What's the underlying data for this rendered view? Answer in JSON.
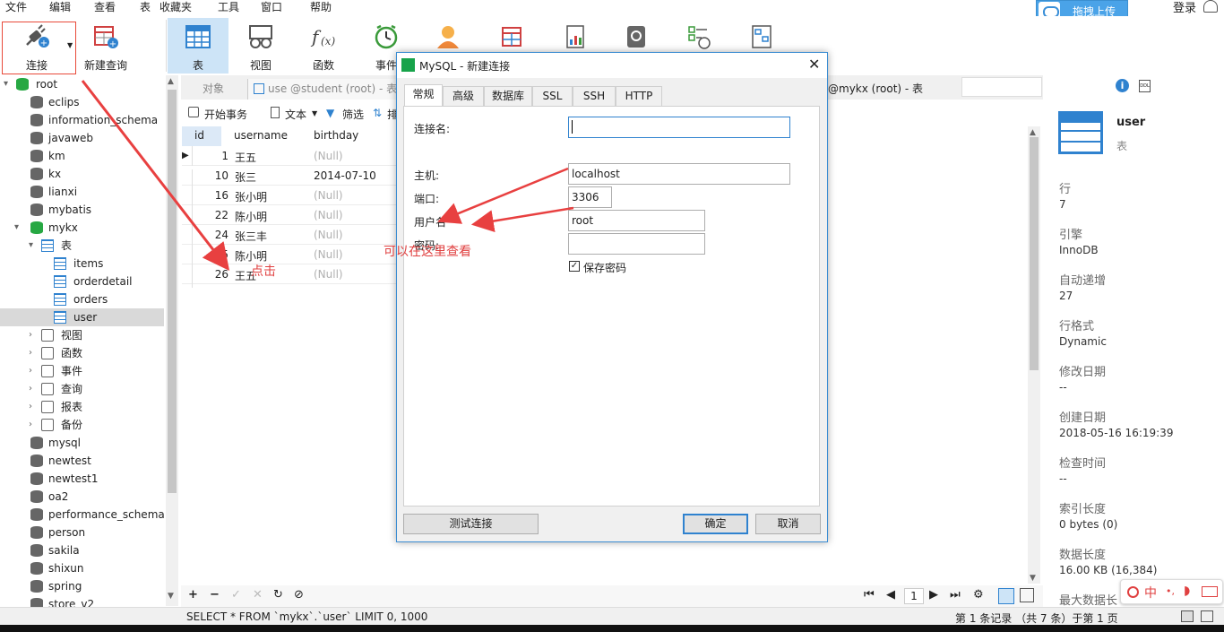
{
  "menu": {
    "items": [
      "文件",
      "编辑",
      "查看",
      "表",
      "收藏夹",
      "工具",
      "窗口",
      "帮助"
    ]
  },
  "topright": {
    "cloud_label": "拖拽上传",
    "login_label": "登录"
  },
  "toolbar": {
    "items": [
      {
        "label": "连接",
        "icon": "plug-icon"
      },
      {
        "label": "新建查询",
        "icon": "new-query-icon"
      },
      {
        "label": "表",
        "icon": "table-icon"
      },
      {
        "label": "视图",
        "icon": "view-icon"
      },
      {
        "label": "函数",
        "icon": "function-icon"
      },
      {
        "label": "事件",
        "icon": "clock-icon"
      }
    ]
  },
  "tree": {
    "root_label": "root",
    "dbs_before": [
      "eclips",
      "information_schema",
      "javaweb",
      "km",
      "kx",
      "lianxi",
      "mybatis"
    ],
    "open_db": "mykx",
    "tables_folder": "表",
    "tables": [
      "items",
      "orderdetail",
      "orders",
      "user"
    ],
    "folders": [
      "视图",
      "函数",
      "事件",
      "查询",
      "报表",
      "备份"
    ],
    "dbs_after": [
      "mysql",
      "newtest",
      "newtest1",
      "oa2",
      "performance_schema",
      "person",
      "sakila",
      "shixun",
      "spring",
      "store_v2"
    ]
  },
  "tabs": {
    "objects": "对象",
    "query_tab": "use @student (root) - 表",
    "right_tab": "@mykx (root) - 表"
  },
  "subtoolbar": {
    "begin_tx": "开始事务",
    "text": "文本",
    "filter": "筛选",
    "sort": "排"
  },
  "grid": {
    "columns": [
      "id",
      "username",
      "birthday"
    ],
    "rows": [
      {
        "id": "1",
        "username": "王五",
        "birthday": "(Null)"
      },
      {
        "id": "10",
        "username": "张三",
        "birthday": "2014-07-10"
      },
      {
        "id": "16",
        "username": "张小明",
        "birthday": "(Null)"
      },
      {
        "id": "22",
        "username": "陈小明",
        "birthday": "(Null)"
      },
      {
        "id": "24",
        "username": "张三丰",
        "birthday": "(Null)"
      },
      {
        "id": "25",
        "username": "陈小明",
        "birthday": "(Null)"
      },
      {
        "id": "26",
        "username": "王五",
        "birthday": "(Null)"
      }
    ]
  },
  "dialog": {
    "title": "MySQL - 新建连接",
    "tabs": [
      "常规",
      "高级",
      "数据库",
      "SSL",
      "SSH",
      "HTTP"
    ],
    "conn_name_label": "连接名:",
    "conn_name_value": "",
    "host_label": "主机:",
    "host_value": "localhost",
    "port_label": "端口:",
    "port_value": "3306",
    "user_label": "用户名",
    "user_value": "root",
    "pass_label": "密码:",
    "pass_value": "",
    "save_pass_label": "保存密码",
    "save_pass_checked": "✓",
    "test_button": "测试连接",
    "ok_button": "确定",
    "cancel_button": "取消"
  },
  "annotations": {
    "click_label": "点击",
    "view_here_label": "可以在这里查看",
    "arrow_color": "#e84040"
  },
  "right_panel": {
    "name": "user",
    "type": "表",
    "props": [
      {
        "label": "行",
        "value": "7"
      },
      {
        "label": "引擎",
        "value": "InnoDB"
      },
      {
        "label": "自动递增",
        "value": "27"
      },
      {
        "label": "行格式",
        "value": "Dynamic"
      },
      {
        "label": "修改日期",
        "value": "--"
      },
      {
        "label": "创建日期",
        "value": "2018-05-16 16:19:39"
      },
      {
        "label": "检查时间",
        "value": "--"
      },
      {
        "label": "索引长度",
        "value": "0 bytes (0)"
      },
      {
        "label": "数据长度",
        "value": "16.00 KB (16,384)"
      },
      {
        "label": "最大数据长",
        "value": ""
      }
    ]
  },
  "bottom": {
    "page": "1",
    "sql": "SELECT * FROM `mykx`.`user` LIMIT 0, 1000",
    "record": "第 1 条记录 （共 7 条）于第 1 页"
  },
  "ime": {
    "label": "中"
  }
}
